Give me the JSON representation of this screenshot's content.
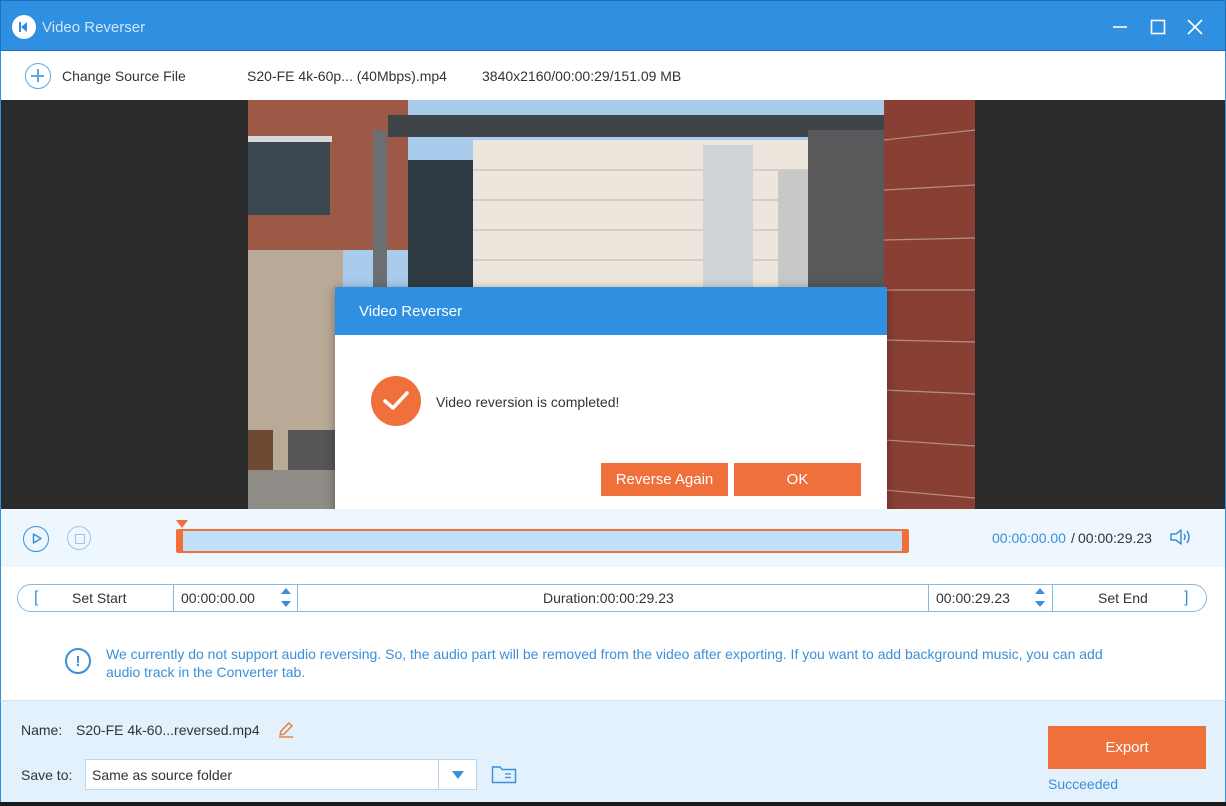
{
  "window": {
    "title": "Video Reverser"
  },
  "source": {
    "change_label": "Change Source File",
    "file_name": "S20-FE 4k-60p... (40Mbps).mp4",
    "file_info": "3840x2160/00:00:29/151.09 MB"
  },
  "dialog": {
    "title": "Video Reverser",
    "message": "Video reversion is completed!",
    "reverse_again_label": "Reverse Again",
    "ok_label": "OK"
  },
  "player": {
    "current_time": "00:00:00.00",
    "separator": "/",
    "total_time": "00:00:29.23"
  },
  "trim": {
    "set_start_label": "Set Start",
    "start_time": "00:00:00.00",
    "duration": "Duration:00:00:29.23",
    "end_time": "00:00:29.23",
    "set_end_label": "Set End"
  },
  "notice": "We currently do not support audio reversing. So, the audio part will be removed from the video after exporting. If you want to add background music, you can add audio track in the Converter tab.",
  "output": {
    "name_label": "Name:",
    "name_value": "S20-FE 4k-60...reversed.mp4",
    "save_label": "Save to:",
    "save_value": "Same as source folder",
    "export_label": "Export",
    "status": "Succeeded"
  },
  "colors": {
    "accent_blue": "#2f8fe0",
    "accent_orange": "#f0703b"
  }
}
